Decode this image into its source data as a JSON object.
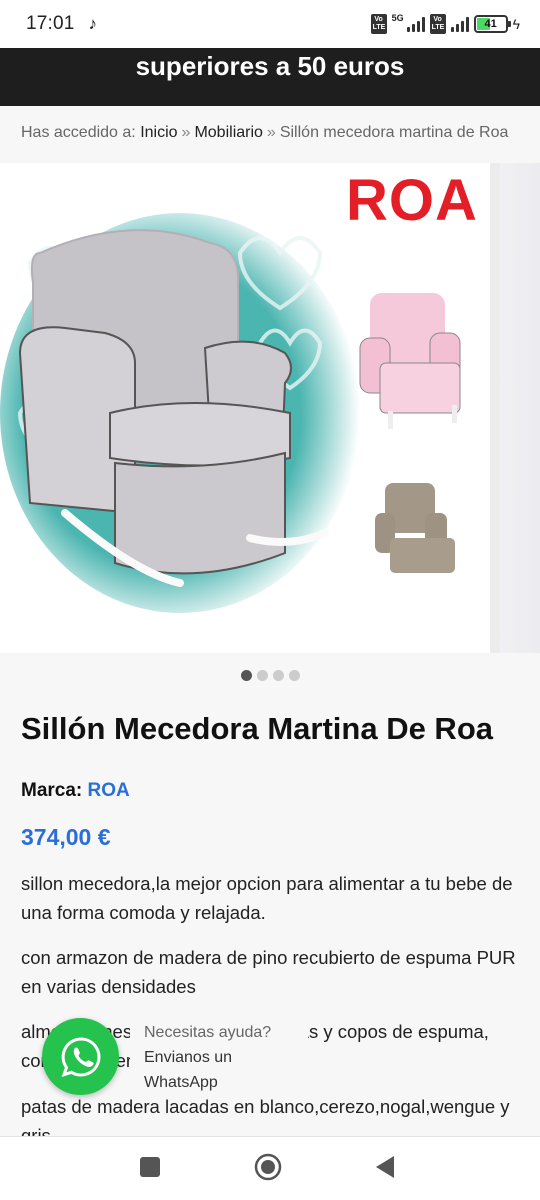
{
  "status_bar": {
    "time": "17:01",
    "network_label": "5G",
    "volte_1": "Vo LTE",
    "volte_2": "Vo LTE",
    "battery_level": "41"
  },
  "banner": {
    "text": "superiores a 50 euros"
  },
  "breadcrumb": {
    "prefix": "Has accedido a:",
    "items": [
      "Inicio",
      "Mobiliario",
      "Sillón mecedora martina de Roa"
    ],
    "separator": "»"
  },
  "gallery": {
    "logo_text": "ROA",
    "slide_count": 4,
    "active_index": 0
  },
  "product": {
    "title": "Sillón Mecedora Martina De Roa",
    "brand_label": "Marca:",
    "brand_name": "ROA",
    "price": "374,00 €",
    "paragraphs": [
      "sillon mecedora,la mejor opcion para alimentar a tu bebe de una forma comoda y relajada.",
      "con armazon de madera de pino recubierto de espuma PUR en varias densidades",
      "almohadones con relleno de plumas y copos de espuma, con cremalleras",
      "patas de madera lacadas en blanco,cerezo,nogal,wengue y gris"
    ]
  },
  "whatsapp": {
    "help_text": "Necesitas ayuda?",
    "cta_text": "Envianos un WhatsApp"
  },
  "colors": {
    "accent": "#2a6fd6",
    "banner_bg": "#1e1e1e",
    "whatsapp_green": "#25c24d",
    "logo_red": "#e41e26"
  }
}
